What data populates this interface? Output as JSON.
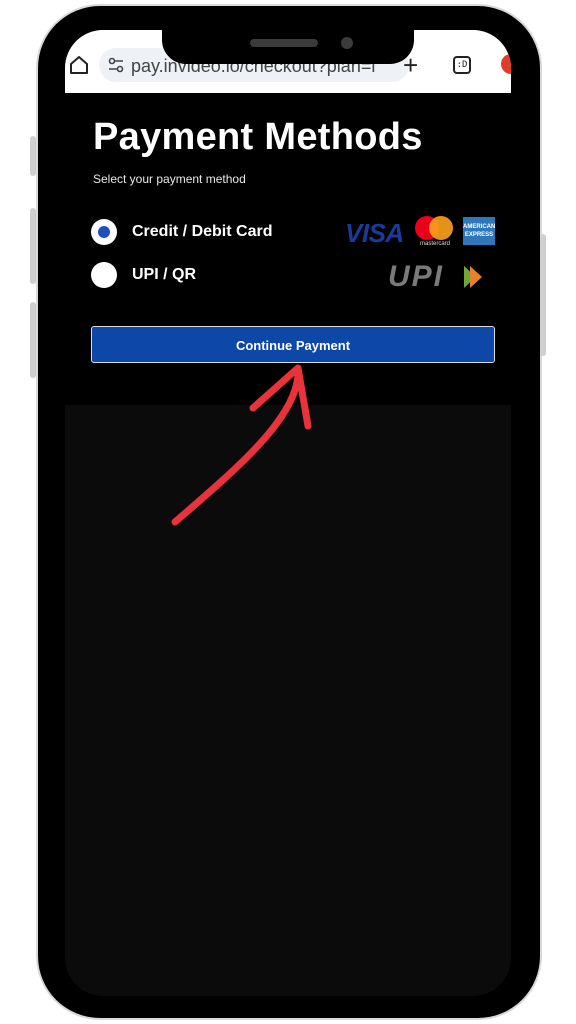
{
  "browser": {
    "url": "pay.invideo.io/checkout?plan=l",
    "tab_count": ":D"
  },
  "page": {
    "title": "Payment Methods",
    "subtitle": "Select your payment method"
  },
  "payment_options": [
    {
      "label": "Credit / Debit Card",
      "selected": true
    },
    {
      "label": "UPI / QR",
      "selected": false
    }
  ],
  "logos": {
    "visa": "VISA",
    "mastercard": "mastercard",
    "amex": "AMERICAN EXPRESS",
    "upi": "UPI"
  },
  "continue_button": {
    "label": "Continue Payment"
  },
  "colors": {
    "accent": "#0d47a8",
    "annotation_arrow": "#e8333a",
    "background": "#0b0b0b"
  }
}
